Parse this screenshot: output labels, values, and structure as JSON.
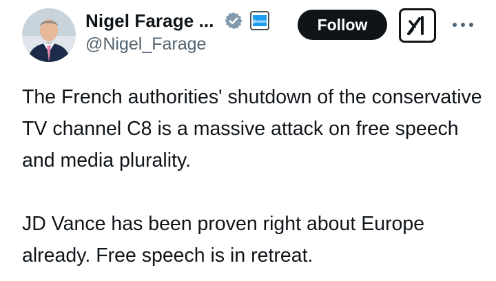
{
  "author": {
    "display_name": "Nigel Farage ...",
    "handle": "@Nigel_Farage",
    "verified_badge_icon": "verified-badge-icon",
    "affiliate_badge_icon": "gb-news-affiliate-icon",
    "affiliate_badge_text": "gbnews"
  },
  "actions": {
    "follow_label": "Follow",
    "grok_icon": "grok-icon",
    "more_icon": "more-options-icon"
  },
  "tweet": {
    "paragraphs": [
      "The French authorities' shutdown of the conservative TV channel C8 is a massive attack on free speech and media plurality.",
      "JD Vance has been proven right about Europe already. Free speech is in retreat."
    ]
  },
  "colors": {
    "text": "#0f1419",
    "secondary_text": "#536471",
    "follow_bg": "#0f1419",
    "badge_grey": "#829aab",
    "affiliate_blue": "#1d9bf0"
  }
}
